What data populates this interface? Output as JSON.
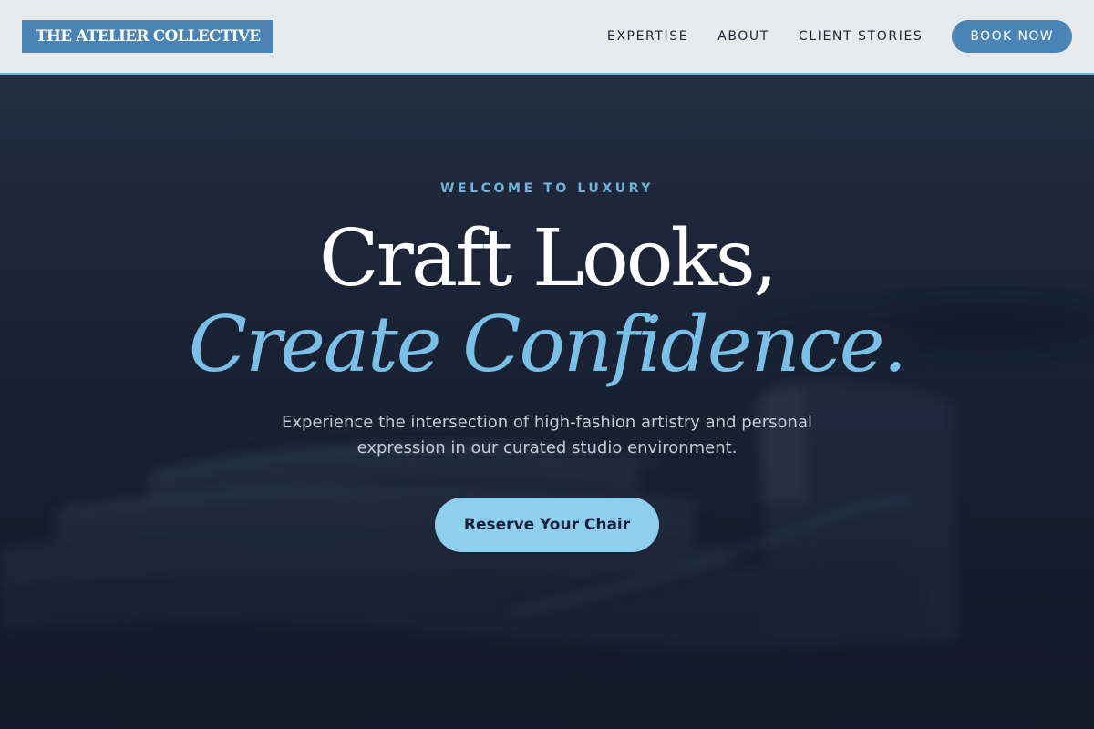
{
  "header": {
    "logo": "THE ATELIER COLLECTIVE",
    "nav": {
      "expertise": "EXPERTISE",
      "about": "ABOUT",
      "client_stories": "CLIENT STORIES"
    },
    "book_now": "BOOK NOW"
  },
  "hero": {
    "eyebrow": "WELCOME TO LUXURY",
    "headline_line1": "Craft Looks,",
    "headline_line2": "Create Confidence.",
    "subtitle": "Experience the intersection of high-fashion artistry and personal expression in our curated studio environment.",
    "cta": "Reserve Your Chair"
  },
  "colors": {
    "nav_background": "#e8e9eb",
    "brand_blue": "#4a83b5",
    "accent_light_blue": "#79bfe6",
    "cta_background": "#8ecfee",
    "hero_background": "#1c2538"
  }
}
